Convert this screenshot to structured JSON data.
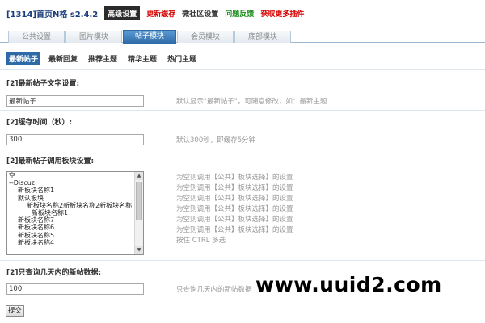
{
  "header": {
    "app_title": "[1314]首页N格 s2.4.2",
    "nav": [
      {
        "label": "高级设置"
      },
      {
        "label": "更新缓存"
      },
      {
        "label": "微社区设置"
      },
      {
        "label": "问题反馈"
      },
      {
        "label": "获取更多插件"
      }
    ]
  },
  "tabs": [
    {
      "label": "公共设置"
    },
    {
      "label": "图片模块"
    },
    {
      "label": "帖子模块"
    },
    {
      "label": "会员模块"
    },
    {
      "label": "底部模块"
    }
  ],
  "subtabs": [
    {
      "label": "最新帖子"
    },
    {
      "label": "最新回复"
    },
    {
      "label": "推荐主题"
    },
    {
      "label": "精华主题"
    },
    {
      "label": "热门主题"
    }
  ],
  "sections": {
    "title_setting": {
      "label": "[2]最新帖子文字设置:",
      "value": "最新帖子",
      "hint": "默认显示\"最新帖子\"，可随意修改，如：最新主题"
    },
    "cache_time": {
      "label": "[2]缓存时间（秒）:",
      "value": "300",
      "hint": "默认300秒，即缓存5分钟"
    },
    "block_setting": {
      "label": "[2]最新帖子调用板块设置:",
      "options": [
        "空",
        "--Discuz!",
        "新板块名称1",
        "默认板块",
        "新板块名称2新板块名称2新板块名称",
        "新板块名称1",
        "新板块名称7",
        "新板块名称6",
        "新板块名称5",
        "新板块名称4"
      ],
      "hints": [
        "为空则调用【公共】板块选择】的设置",
        "为空则调用【公共】板块选择】的设置",
        "为空则调用【公共】板块选择】的设置",
        "为空则调用【公共】板块选择】的设置",
        "为空则调用【公共】板块选择】的设置",
        "为空则调用【公共】板块选择】的设置",
        "按住 CTRL 多选"
      ]
    },
    "days_limit": {
      "label": "[2]只查询几天内的新帖数据:",
      "value": "100",
      "hint": "只查询几天内的新帖数据"
    }
  },
  "submit_label": "提交",
  "watermark": "www.uuid2.com"
}
